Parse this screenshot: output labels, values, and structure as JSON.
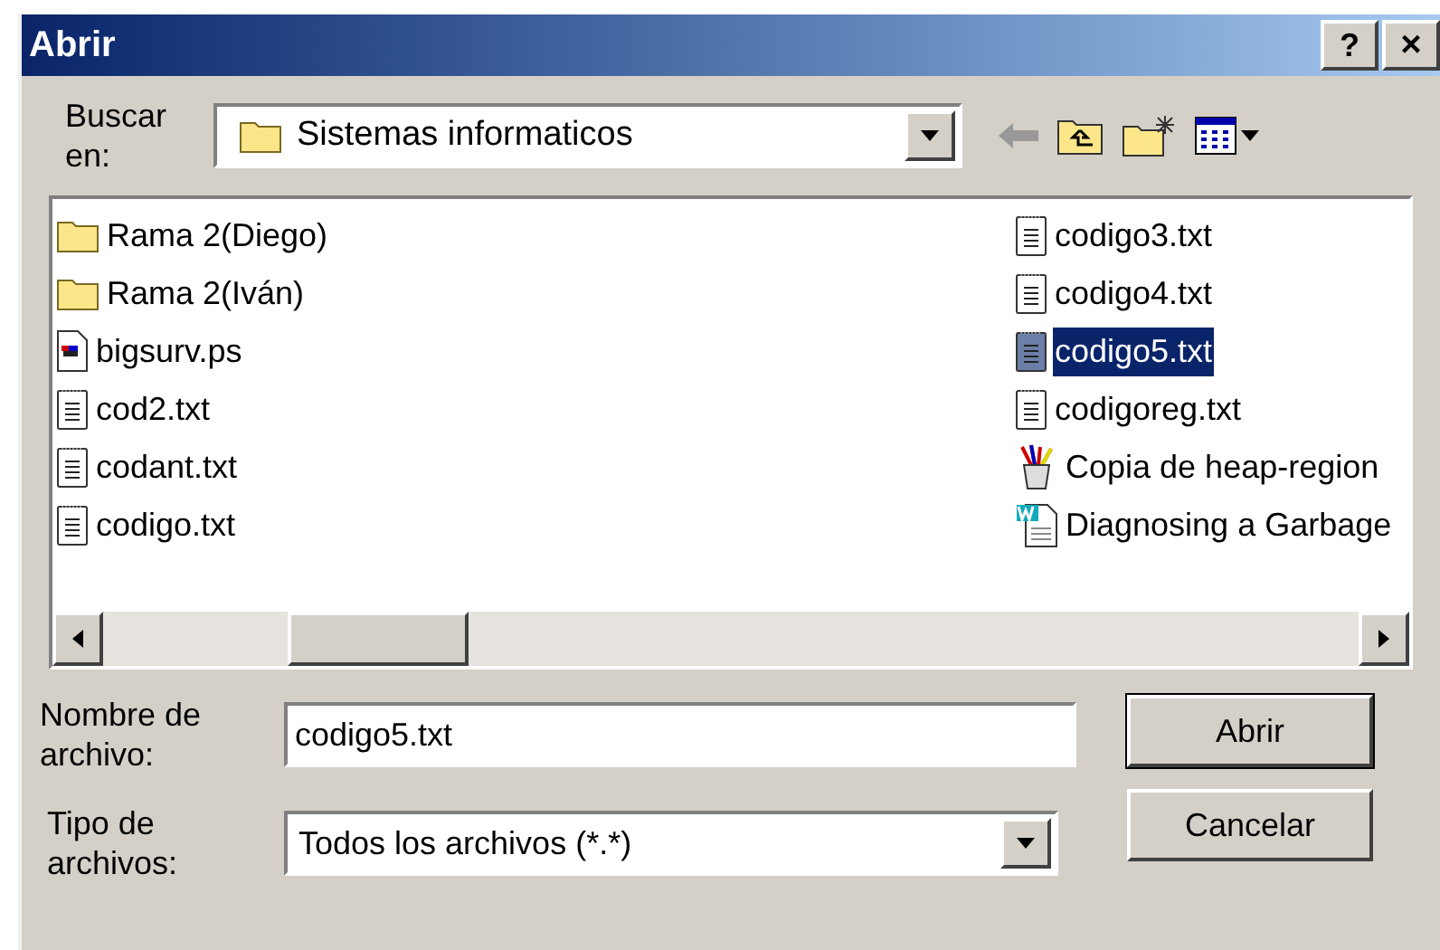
{
  "window": {
    "title": "Abrir",
    "help": "?",
    "close": "×"
  },
  "look_in": {
    "label": "Buscar en:",
    "value": "Sistemas informaticos"
  },
  "files": [
    {
      "name": "Rama 2(Diego)",
      "kind": "folder",
      "selected": false
    },
    {
      "name": "Rama 2(Iván)",
      "kind": "folder",
      "selected": false
    },
    {
      "name": "bigsurv.ps",
      "kind": "ps",
      "selected": false
    },
    {
      "name": "cod2.txt",
      "kind": "txt",
      "selected": false
    },
    {
      "name": "codant.txt",
      "kind": "txt",
      "selected": false
    },
    {
      "name": "codigo.txt",
      "kind": "txt",
      "selected": false
    },
    {
      "name": "codigo3.txt",
      "kind": "txt",
      "selected": false
    },
    {
      "name": "codigo4.txt",
      "kind": "txt",
      "selected": false
    },
    {
      "name": "codigo5.txt",
      "kind": "txt",
      "selected": true
    },
    {
      "name": "codigoreg.txt",
      "kind": "txt",
      "selected": false
    },
    {
      "name": "Copia de heap-region",
      "kind": "app",
      "selected": false
    },
    {
      "name": "Diagnosing a Garbage",
      "kind": "word",
      "selected": false
    }
  ],
  "file_name": {
    "label": "Nombre de archivo:",
    "value": "codigo5.txt"
  },
  "file_type": {
    "label": "Tipo de archivos:",
    "value": "Todos los archivos (*.*)"
  },
  "buttons": [
    {
      "label": "Abrir",
      "default": true
    },
    {
      "label": "Cancelar",
      "default": false
    }
  ]
}
